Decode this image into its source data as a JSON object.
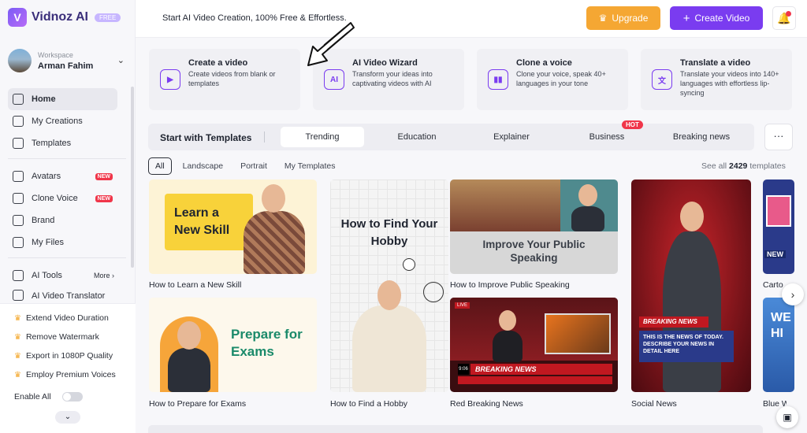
{
  "brand": {
    "name": "Vidnoz AI",
    "badge": "FREE",
    "mark": "V"
  },
  "workspace": {
    "label": "Workspace",
    "name": "Arman Fahim"
  },
  "nav": [
    {
      "label": "Home",
      "active": true
    },
    {
      "label": "My Creations"
    },
    {
      "label": "Templates"
    },
    {
      "label": "Avatars",
      "badge": "NEW"
    },
    {
      "label": "Clone Voice",
      "badge": "NEW"
    },
    {
      "label": "Brand"
    },
    {
      "label": "My Files"
    },
    {
      "label": "AI Tools",
      "more": "More"
    },
    {
      "label": "AI Video Translator"
    }
  ],
  "upsell": {
    "items": [
      "Extend Video Duration",
      "Remove Watermark",
      "Export in 1080P Quality",
      "Employ Premium Voices"
    ],
    "enable_all": "Enable All"
  },
  "topbar": {
    "tagline": "Start AI Video Creation, 100% Free & Effortless.",
    "upgrade": "Upgrade",
    "create": "Create Video"
  },
  "quick_actions": [
    {
      "title": "Create a video",
      "desc": "Create videos from blank or templates"
    },
    {
      "title": "AI Video Wizard",
      "desc": "Transform your ideas into captivating videos with AI"
    },
    {
      "title": "Clone a voice",
      "desc": "Clone your voice, speak 40+ languages in your tone"
    },
    {
      "title": "Translate a video",
      "desc": "Translate your videos into 140+ languages with effortless lip-syncing"
    }
  ],
  "templates": {
    "title": "Start with Templates",
    "tabs": [
      "Trending",
      "Education",
      "Explainer",
      "Business",
      "Breaking news"
    ],
    "hot": "HOT",
    "more": "···"
  },
  "filters": [
    "All",
    "Landscape",
    "Portrait",
    "My Templates"
  ],
  "see_all": {
    "prefix": "See all",
    "count": "2429",
    "suffix": "templates"
  },
  "cards": [
    {
      "caption": "How to Learn a New Skill",
      "title": "Learn a New Skill"
    },
    {
      "caption": "How to Prepare for Exams",
      "title": "Prepare for Exams"
    },
    {
      "caption": "How to Find a Hobby",
      "title": "How to Find Your Hobby"
    },
    {
      "caption": "How to Improve Public Speaking",
      "title": "Improve Your Public Speaking"
    },
    {
      "caption": "Red Breaking News",
      "title": "BREAKING NEWS",
      "time": "9:06",
      "live": "LIVE"
    },
    {
      "caption": "Social News",
      "title": "BREAKING NEWS",
      "body": "THIS IS THE NEWS OF TODAY. DESCRIBE YOUR NEWS IN DETAIL HERE"
    },
    {
      "caption": "Carto",
      "title": "NEW"
    },
    {
      "caption": "Blue Wh",
      "title": "WE HI"
    }
  ]
}
